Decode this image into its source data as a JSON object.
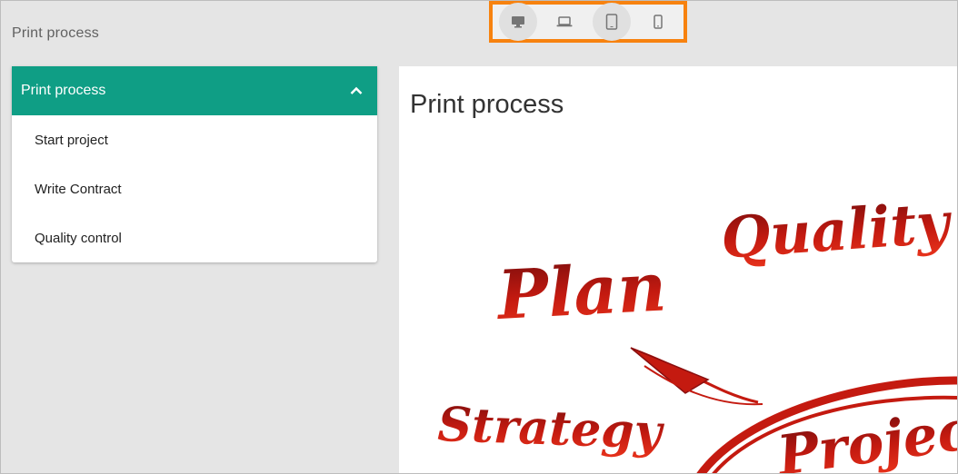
{
  "page": {
    "title": "Print process"
  },
  "device_toolbar": {
    "buttons": [
      {
        "icon": "desktop-icon",
        "active": true
      },
      {
        "icon": "laptop-icon",
        "active": false
      },
      {
        "icon": "tablet-icon",
        "active": true
      },
      {
        "icon": "phone-icon",
        "active": false
      }
    ],
    "highlight_color": "#f7820f"
  },
  "sidebar": {
    "header": "Print process",
    "accent_color": "#0f9e85",
    "items": [
      {
        "label": "Start project"
      },
      {
        "label": "Write Contract"
      },
      {
        "label": "Quality control"
      }
    ]
  },
  "content": {
    "title": "Print process",
    "image_words": [
      "Quality",
      "Plan",
      "Strategy",
      "Project"
    ],
    "image_color": "#c41a10"
  }
}
